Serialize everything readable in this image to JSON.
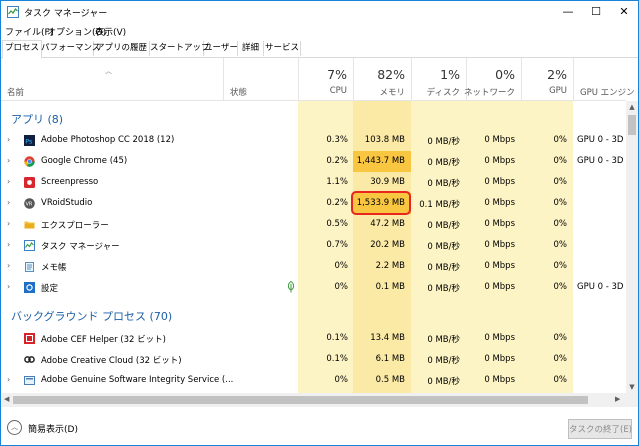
{
  "window": {
    "title": "タスク マネージャー",
    "minimize": "—",
    "maximize": "☐",
    "close": "✕"
  },
  "menu": [
    "ファイル(F)",
    "オプション(O)",
    "表示(V)"
  ],
  "tabs": [
    "プロセス",
    "パフォーマンス",
    "アプリの履歴",
    "スタートアップ",
    "ユーザー",
    "詳細",
    "サービス"
  ],
  "header": {
    "name": "名前",
    "status": "状態",
    "cpu_pct": "7%",
    "cpu": "CPU",
    "mem_pct": "82%",
    "mem": "メモリ",
    "disk_pct": "1%",
    "disk": "ディスク",
    "net_pct": "0%",
    "net": "ネットワーク",
    "gpu_pct": "2%",
    "gpu": "GPU",
    "gpu_engine": "GPU エンジン"
  },
  "apps_group": "アプリ (8)",
  "apps": [
    {
      "name": "Adobe Photoshop CC 2018 (12)",
      "cpu": "0.3%",
      "mem": "103.8 MB",
      "disk": "0 MB/秒",
      "net": "0 Mbps",
      "gpu": "0%",
      "engine": "GPU 0 - 3D",
      "icon": "photoshop-icon"
    },
    {
      "name": "Google Chrome (45)",
      "cpu": "0.2%",
      "mem": "1,443.7 MB",
      "disk": "0 MB/秒",
      "net": "0 Mbps",
      "gpu": "0%",
      "engine": "GPU 0 - 3D",
      "icon": "chrome-icon"
    },
    {
      "name": "Screenpresso",
      "cpu": "1.1%",
      "mem": "30.9 MB",
      "disk": "0 MB/秒",
      "net": "0 Mbps",
      "gpu": "0%",
      "engine": "",
      "icon": "screenpresso-icon"
    },
    {
      "name": "VRoidStudio",
      "cpu": "0.2%",
      "mem": "1,533.9 MB",
      "disk": "0.1 MB/秒",
      "net": "0 Mbps",
      "gpu": "0%",
      "engine": "",
      "icon": "vroid-icon"
    },
    {
      "name": "エクスプローラー",
      "cpu": "0.5%",
      "mem": "47.2 MB",
      "disk": "0 MB/秒",
      "net": "0 Mbps",
      "gpu": "0%",
      "engine": "",
      "icon": "explorer-icon"
    },
    {
      "name": "タスク マネージャー",
      "cpu": "0.7%",
      "mem": "20.2 MB",
      "disk": "0 MB/秒",
      "net": "0 Mbps",
      "gpu": "0%",
      "engine": "",
      "icon": "task-manager-icon"
    },
    {
      "name": "メモ帳",
      "cpu": "0%",
      "mem": "2.2 MB",
      "disk": "0 MB/秒",
      "net": "0 Mbps",
      "gpu": "0%",
      "engine": "",
      "icon": "notepad-icon"
    },
    {
      "name": "設定",
      "cpu": "0%",
      "mem": "0.1 MB",
      "disk": "0 MB/秒",
      "net": "0 Mbps",
      "gpu": "0%",
      "engine": "GPU 0 - 3D",
      "icon": "settings-icon"
    }
  ],
  "bg_group": "バックグラウンド プロセス (70)",
  "bg": [
    {
      "name": "Adobe CEF Helper (32 ビット)",
      "cpu": "0.1%",
      "mem": "13.4 MB",
      "disk": "0 MB/秒",
      "net": "0 Mbps",
      "gpu": "0%",
      "engine": "",
      "icon": "adobe-cef-icon"
    },
    {
      "name": "Adobe Creative Cloud (32 ビット)",
      "cpu": "0.1%",
      "mem": "6.1 MB",
      "disk": "0 MB/秒",
      "net": "0 Mbps",
      "gpu": "0%",
      "engine": "",
      "icon": "creative-cloud-icon"
    },
    {
      "name": "Adobe Genuine Software Integrity Service (...",
      "cpu": "0%",
      "mem": "0.5 MB",
      "disk": "0 MB/秒",
      "net": "0 Mbps",
      "gpu": "0%",
      "engine": "",
      "icon": "adobe-genuine-icon"
    }
  ],
  "footer": {
    "fewer_details": "簡易表示(D)",
    "end_task": "タスクの終了(E)"
  },
  "colors": {
    "accent": "#1c5fa7",
    "highlight": "#e8261f",
    "cpu_col": "#fdf4c5",
    "mem_col": "#fbe9a6",
    "mem_hot": "#f9c642"
  }
}
